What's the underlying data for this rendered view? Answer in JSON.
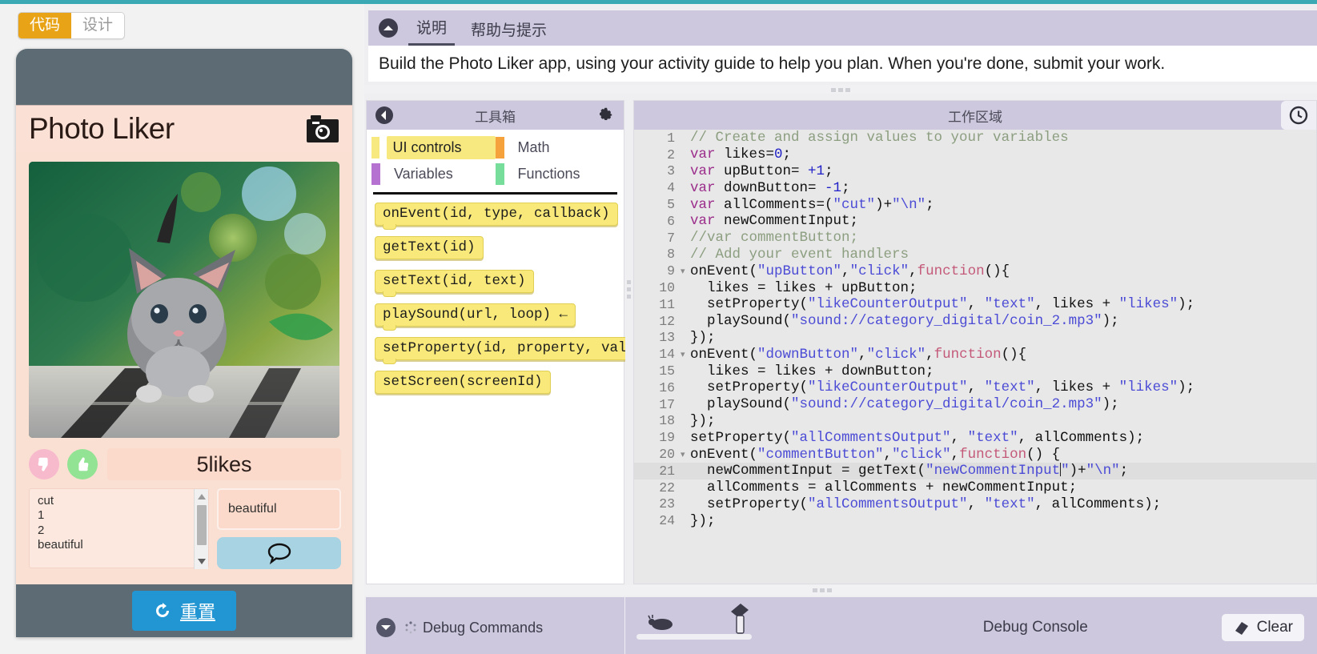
{
  "mode_toggle": {
    "code_label": "代码",
    "design_label": "设计"
  },
  "phone": {
    "app_title": "Photo Liker",
    "camera_icon": "camera-icon",
    "dislike_icon": "thumbs-down-icon",
    "like_icon": "thumbs-up-icon",
    "like_counter_text": "5likes",
    "comments_output": "cut\n1\n2\nbeautiful",
    "comment_input_value": "beautiful",
    "comment_button_icon": "speech-bubble-icon",
    "reset_label": "重置",
    "reset_icon": "refresh-icon"
  },
  "instructions": {
    "collapse_icon": "collapse-up-icon",
    "tabs": [
      {
        "label": "说明",
        "active": true
      },
      {
        "label": "帮助与提示",
        "active": false
      }
    ],
    "text": "Build the Photo Liker app, using your activity guide to help you plan. When you're done, submit your work."
  },
  "toolbox": {
    "back_icon": "back-arrow-icon",
    "title": "工具箱",
    "gear_icon": "gear-icon",
    "categories": [
      {
        "label": "UI controls",
        "color": "#f7e97f",
        "selected": true
      },
      {
        "label": "Math",
        "color": "#f5a23c",
        "selected": false
      },
      {
        "label": "Variables",
        "color": "#b672d1",
        "selected": false
      },
      {
        "label": "Functions",
        "color": "#77dd9b",
        "selected": false
      }
    ],
    "blocks": [
      {
        "name": "onEvent",
        "text": "onEvent(id, type, callback)"
      },
      {
        "name": "getText",
        "text": "getText(id)"
      },
      {
        "name": "setText",
        "text": "setText(id, text)"
      },
      {
        "name": "playSound",
        "text": "playSound(url, loop) ←"
      },
      {
        "name": "setProperty",
        "text": "setProperty(id, property, val"
      },
      {
        "name": "setScreen",
        "text": "setScreen(screenId)"
      }
    ]
  },
  "workspace": {
    "title": "工作区域",
    "clock_icon": "version-history-clock-icon",
    "active_line": 21,
    "lines": [
      {
        "n": 1,
        "fold": false,
        "text": "// Create and assign values to your variables"
      },
      {
        "n": 2,
        "fold": false,
        "text": "var likes=0;"
      },
      {
        "n": 3,
        "fold": false,
        "text": "var upButton= +1;"
      },
      {
        "n": 4,
        "fold": false,
        "text": "var downButton= -1;"
      },
      {
        "n": 5,
        "fold": false,
        "text": "var allComments=(\"cut\")+\"\\n\";"
      },
      {
        "n": 6,
        "fold": false,
        "text": "var newCommentInput;"
      },
      {
        "n": 7,
        "fold": false,
        "text": "//var commentButton;"
      },
      {
        "n": 8,
        "fold": false,
        "text": "// Add your event handlers"
      },
      {
        "n": 9,
        "fold": true,
        "text": "onEvent(\"upButton\",\"click\",function(){"
      },
      {
        "n": 10,
        "fold": false,
        "text": "  likes = likes + upButton;"
      },
      {
        "n": 11,
        "fold": false,
        "text": "  setProperty(\"likeCounterOutput\", \"text\", likes + \"likes\");"
      },
      {
        "n": 12,
        "fold": false,
        "text": "  playSound(\"sound://category_digital/coin_2.mp3\");"
      },
      {
        "n": 13,
        "fold": false,
        "text": "});"
      },
      {
        "n": 14,
        "fold": true,
        "text": "onEvent(\"downButton\",\"click\",function(){"
      },
      {
        "n": 15,
        "fold": false,
        "text": "  likes = likes + downButton;"
      },
      {
        "n": 16,
        "fold": false,
        "text": "  setProperty(\"likeCounterOutput\", \"text\", likes + \"likes\");"
      },
      {
        "n": 17,
        "fold": false,
        "text": "  playSound(\"sound://category_digital/coin_2.mp3\");"
      },
      {
        "n": 18,
        "fold": false,
        "text": "});"
      },
      {
        "n": 19,
        "fold": false,
        "text": "setProperty(\"allCommentsOutput\", \"text\", allComments);"
      },
      {
        "n": 20,
        "fold": true,
        "text": "onEvent(\"commentButton\",\"click\",function() {"
      },
      {
        "n": 21,
        "fold": false,
        "text": "  newCommentInput = getText(\"newCommentInput\")+\"\\n\";"
      },
      {
        "n": 22,
        "fold": false,
        "text": "  allComments = allComments + newCommentInput;"
      },
      {
        "n": 23,
        "fold": false,
        "text": "  setProperty(\"allCommentsOutput\", \"text\", allComments);"
      },
      {
        "n": 24,
        "fold": false,
        "text": "});"
      }
    ]
  },
  "debug_commands": {
    "chevron_icon": "chevron-down-icon",
    "spinner_icon": "spinner-icon",
    "label": "Debug Commands"
  },
  "debug_console": {
    "turtle_icon": "turtle-icon",
    "hammer_icon": "hammer-slider-icon",
    "title": "Debug Console",
    "clear_label": "Clear",
    "clear_icon": "eraser-icon"
  }
}
